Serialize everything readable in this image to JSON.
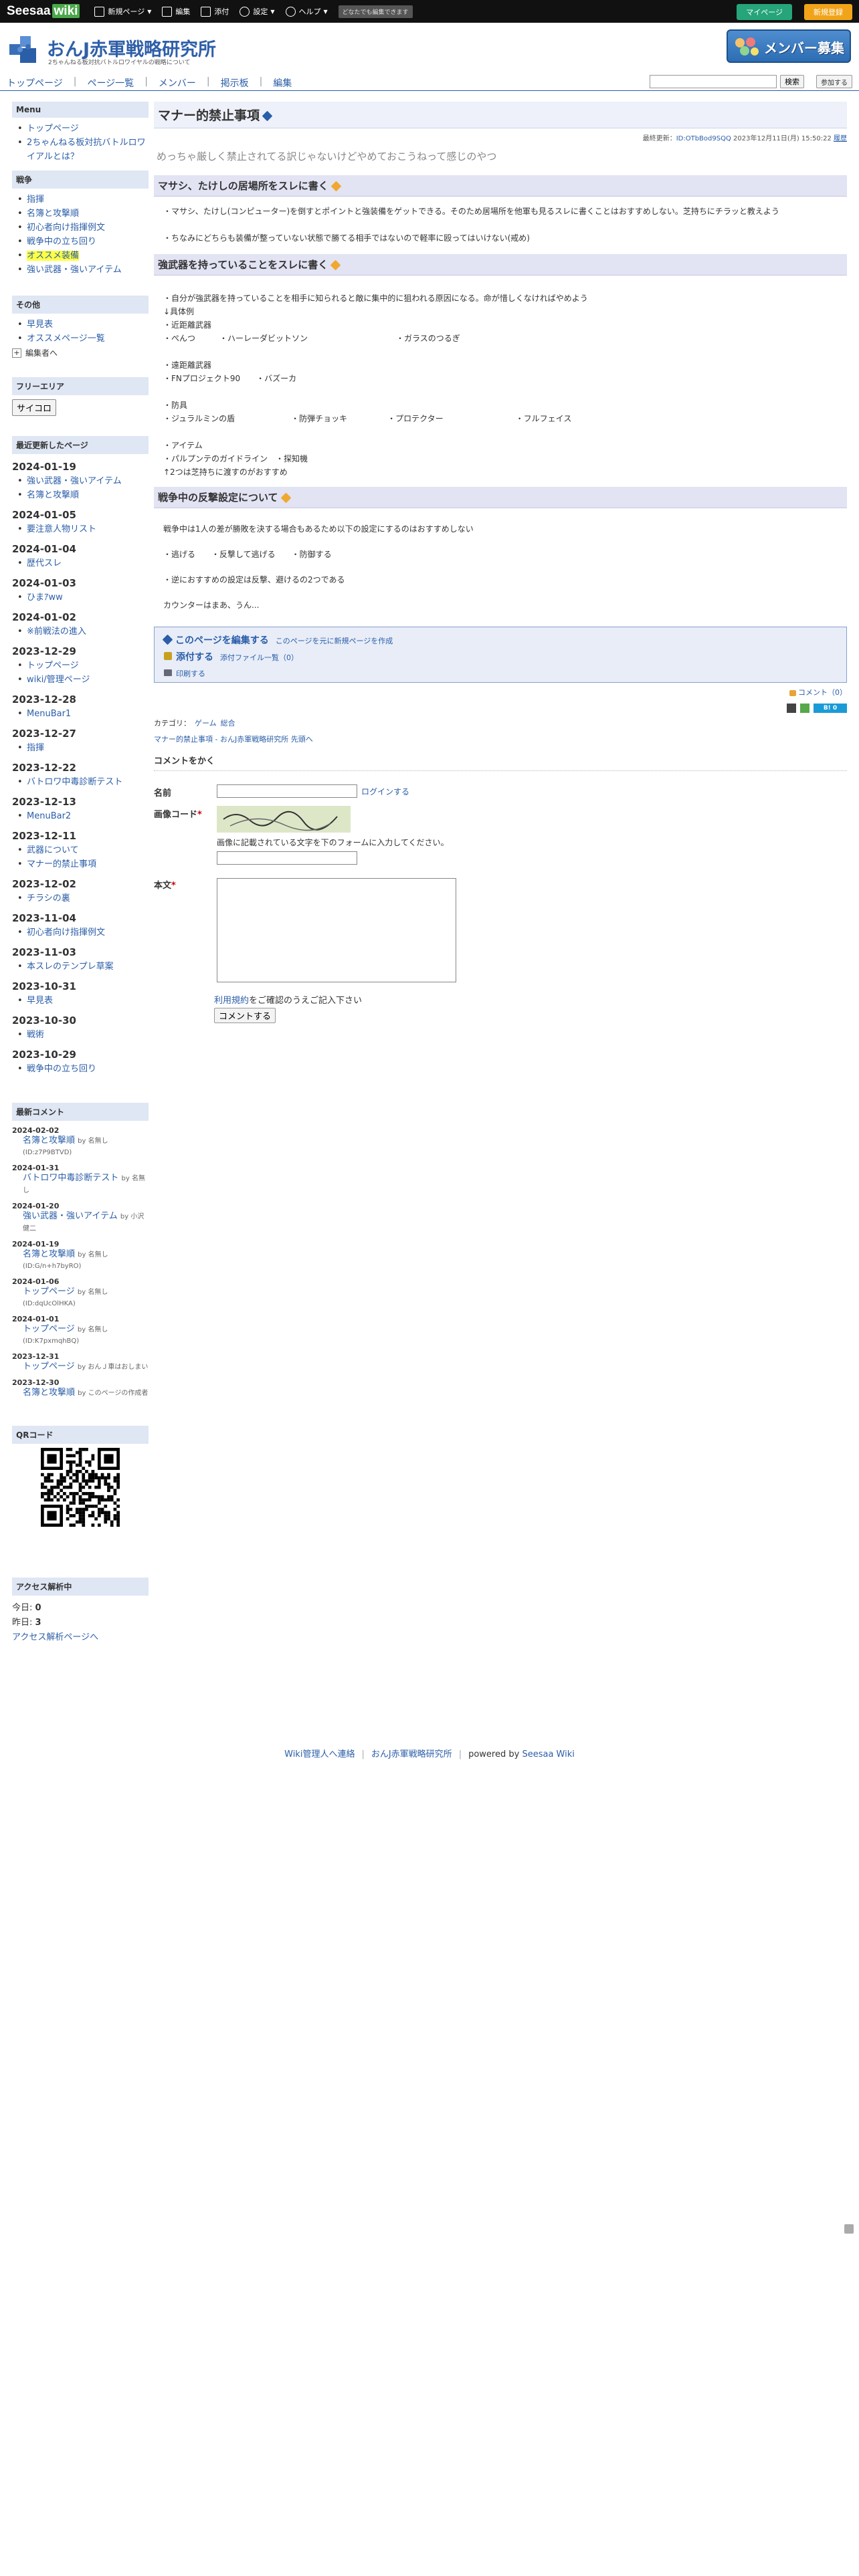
{
  "topbar": {
    "logo": "Seesaa",
    "logo_wiki": "wiki",
    "menu": [
      {
        "label": "新規ページ",
        "caret": "▼"
      },
      {
        "label": "編集",
        "caret": ""
      },
      {
        "label": "添付",
        "caret": ""
      },
      {
        "label": "設定",
        "caret": "▼"
      },
      {
        "label": "ヘルプ",
        "caret": "▼"
      }
    ],
    "anyone_badge": "どなたでも編集できます",
    "mypage": "マイページ",
    "register": "新規登録"
  },
  "header": {
    "title": "おんJ赤軍戦略研究所",
    "description": "2ちゃんねる板対抗バトルロワイヤルの戦略について",
    "banner": "メンバー募集"
  },
  "nav": {
    "links": [
      "トップページ",
      "ページ一覧",
      "メンバー",
      "掲示板",
      "編集"
    ],
    "search_button": "検索",
    "join_button": "参加する"
  },
  "sidebar": {
    "menu_title": "Menu",
    "menu_items": [
      "トップページ",
      "2ちゃんねる板対抗バトルロワイアルとは？"
    ],
    "war_title": "戦争",
    "war_items": [
      {
        "label": "指揮",
        "highlight": false
      },
      {
        "label": "名簿と攻撃順",
        "highlight": false
      },
      {
        "label": "初心者向け指揮例文",
        "highlight": false
      },
      {
        "label": "戦争中の立ち回り",
        "highlight": false
      },
      {
        "label": "オススメ装備",
        "highlight": true
      },
      {
        "label": "強い武器・強いアイテム",
        "highlight": false
      }
    ],
    "other_title": "その他",
    "other_items": [
      "早見表",
      "オススメページ一覧"
    ],
    "other_toggle": "編集者へ",
    "free_title": "フリーエリア",
    "free_button": "サイコロ",
    "recent_title": "最近更新したページ",
    "recent": [
      {
        "date": "2024-01-19",
        "items": [
          "強い武器・強いアイテム",
          "名簿と攻撃順"
        ]
      },
      {
        "date": "2024-01-05",
        "items": [
          "要注意人物リスト"
        ]
      },
      {
        "date": "2024-01-04",
        "items": [
          "歴代スレ"
        ]
      },
      {
        "date": "2024-01-03",
        "items": [
          "ひまｱww"
        ]
      },
      {
        "date": "2024-01-02",
        "items": [
          "※前戦法の進入"
        ]
      },
      {
        "date": "2023-12-29",
        "items": [
          "トップページ",
          "wiki/管理ページ"
        ]
      },
      {
        "date": "2023-12-28",
        "items": [
          "MenuBar1"
        ]
      },
      {
        "date": "2023-12-27",
        "items": [
          "指揮"
        ]
      },
      {
        "date": "2023-12-22",
        "items": [
          "バトロワ中毒診断テスト"
        ]
      },
      {
        "date": "2023-12-13",
        "items": [
          "MenuBar2"
        ]
      },
      {
        "date": "2023-12-11",
        "items": [
          "武器について",
          "マナー的禁止事項"
        ]
      },
      {
        "date": "2023-12-02",
        "items": [
          "チラシの裏"
        ]
      },
      {
        "date": "2023-11-04",
        "items": [
          "初心者向け指揮例文"
        ]
      },
      {
        "date": "2023-11-03",
        "items": [
          "本スレのテンプレ草案"
        ]
      },
      {
        "date": "2023-10-31",
        "items": [
          "早見表"
        ]
      },
      {
        "date": "2023-10-30",
        "items": [
          "戦術"
        ]
      },
      {
        "date": "2023-10-29",
        "items": [
          "戦争中の立ち回り"
        ]
      }
    ],
    "comments_title": "最新コメント",
    "comments": [
      {
        "date": "2024-02-02",
        "page": "名簿と攻撃順",
        "by": "by 名無し",
        "sub": "(ID:z7P9BTVD)"
      },
      {
        "date": "2024-01-31",
        "page": "バトロワ中毒診断テスト",
        "by": "by 名無し",
        "sub": ""
      },
      {
        "date": "2024-01-20",
        "page": "強い武器・強いアイテム",
        "by": "by 小沢健二",
        "sub": ""
      },
      {
        "date": "2024-01-19",
        "page": "名簿と攻撃順",
        "by": "by 名無し",
        "sub": "(ID:G/n+h7byRO)"
      },
      {
        "date": "2024-01-06",
        "page": "トップページ",
        "by": "by 名無し",
        "sub": "(ID:dqUcOlHKA)"
      },
      {
        "date": "2024-01-01",
        "page": "トップページ",
        "by": "by 名無し",
        "sub": "(ID:K7pxmqhBQ)"
      },
      {
        "date": "2023-12-31",
        "page": "トップページ",
        "by": "by おんＪ車はおしまい",
        "sub": ""
      },
      {
        "date": "2023-12-30",
        "page": "名簿と攻撃順",
        "by": "by このページの作成者",
        "sub": ""
      }
    ],
    "qr_title": "QRコード",
    "access_title": "アクセス解析中",
    "today_label": "今日:",
    "today_value": "0",
    "yesterday_label": "昨日:",
    "yesterday_value": "3",
    "access_link": "アクセス解析ページへ"
  },
  "main": {
    "title": "マナー的禁止事項",
    "updated_label": "最終更新：",
    "updated_id": "ID:OTbBod9SQQ",
    "updated_date": "2023年12月11日(月) 15:50:22",
    "history": "履歴",
    "lead": "めっちゃ厳しく禁止されてる訳じゃないけどやめておこうねって感じのやつ",
    "sections": [
      {
        "heading": "マサシ、たけしの居場所をスレに書く",
        "body": "・マサシ、たけし(コンピューター)を倒すとポイントと強装備をゲットできる。そのため居場所を他軍も見るスレに書くことはおすすめしない。芝持ちにチラッと教えよう\n\n・ちなみにどちらも装備が整っていない状態で勝てる相手ではないので軽率に殴ってはいけない(戒め)"
      },
      {
        "heading": "強武器を持っていることをスレに書く",
        "body": "・自分が強武器を持っていることを相手に知られると敵に集中的に狙われる原因になる。命が惜しくなければやめよう\n↓具体例\n・近距離武器\n・ぺんつ　　　・ハーレーダビットソン　　　　　　　　　　　・ガラスのつるぎ\n\n・遠距離武器\n・FNプロジェクト90　　・バズーカ\n\n・防具\n・ジュラルミンの盾　　　　　　　・防弾チョッキ　　　　　・プロテクター　　　　　　　　　・フルフェイス\n\n・アイテム\n・パルプンテのガイドライン　・探知機\n↑2つは芝持ちに渡すのがおすすめ"
      },
      {
        "heading": "戦争中の反撃設定について",
        "body": "戦争中は1人の差が勝敗を決する場合もあるため以下の設定にするのはおすすめしない\n\n・逃げる　　・反撃して逃げる　　・防御する\n\n・逆におすすめの設定は反撃、避けるの2つである\n\nカウンターはまあ、うん..."
      }
    ],
    "editbox": {
      "edit_label": "このページを編集する",
      "edit_sub": "このページを元に新規ページを作成",
      "attach_label": "添付する",
      "attach_sub": "添付ファイル一覧（0）",
      "print": "印刷する"
    },
    "comment_link": "コメント（0）",
    "category_label": "カテゴリ：",
    "categories": [
      "ゲーム",
      "総合"
    ],
    "breadcrumb": "マナー的禁止事項 - おんJ赤軍戦略研究所 先頭へ",
    "comment_heading": "コメントをかく",
    "form": {
      "name_label": "名前",
      "login": "ログインする",
      "captcha_label": "画像コード",
      "captcha_note": "画像に記載されている文字を下のフォームに入力してください。",
      "body_label": "本文",
      "terms_link": "利用規約",
      "terms_text": "をご確認のうえご記入下さい",
      "submit": "コメントする"
    }
  },
  "footer": {
    "contact": "Wiki管理人へ連絡",
    "site": "おんJ赤軍戦略研究所",
    "powered": "powered by",
    "seesaa": "Seesaa Wiki"
  },
  "colors": {
    "accent": "#2b5ea8",
    "heading_bg": "#e2e3f3",
    "sidebar_heading_bg": "#dfe6f4",
    "mypage": "#26a47a",
    "register": "#f1a419"
  }
}
